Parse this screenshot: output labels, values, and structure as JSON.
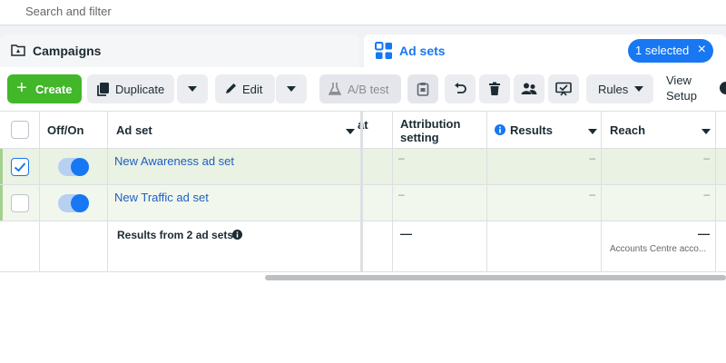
{
  "search": {
    "placeholder": "Search and filter"
  },
  "tabs": {
    "campaigns": {
      "label": "Campaigns"
    },
    "ad_sets": {
      "label": "Ad sets"
    },
    "selected_pill": {
      "label": "1 selected",
      "close": "×"
    }
  },
  "toolbar": {
    "create": "Create",
    "duplicate": "Duplicate",
    "edit": "Edit",
    "ab_test": "A/B test",
    "rules": "Rules",
    "view_setup_line1": "View",
    "view_setup_line2": "Setup",
    "icons": [
      "plus-icon",
      "duplicate-icon",
      "pencil-icon",
      "flask-icon",
      "clipboard-icon",
      "undo-icon",
      "trash-icon",
      "people-icon",
      "preview-icon"
    ]
  },
  "table": {
    "headers": {
      "off_on": "Off/On",
      "ad_set": "Ad set",
      "partial": "at",
      "attribution_line1": "Attribution",
      "attribution_line2": "setting",
      "results": "Results",
      "reach": "Reach"
    },
    "rows": [
      {
        "name": "New Awareness ad set",
        "checked": true,
        "on": true,
        "attribution": "–",
        "results": "–",
        "reach": "–"
      },
      {
        "name": "New Traffic ad set",
        "checked": false,
        "on": true,
        "attribution": "–",
        "results": "–",
        "reach": "–"
      }
    ],
    "summary": {
      "label": "Results from 2 ad sets",
      "attribution": "—",
      "reach": "—",
      "reach_note": "Accounts Centre acco..."
    }
  },
  "colors": {
    "accent": "#1877f2",
    "create_green": "#42b72a",
    "selected_row": "#e9f2e3",
    "link": "#1f5fbf"
  }
}
